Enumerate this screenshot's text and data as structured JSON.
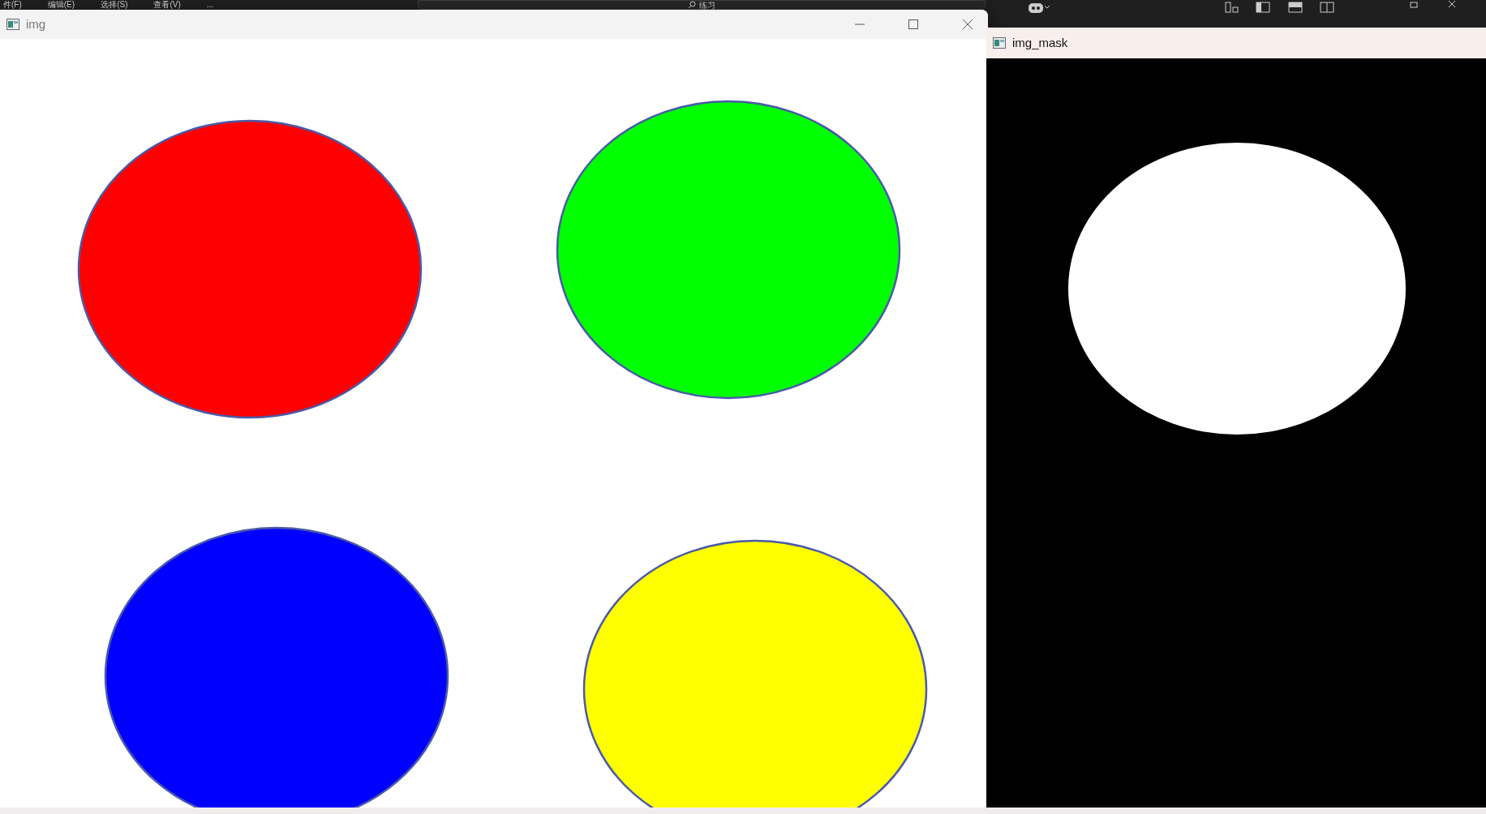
{
  "ide_menu": [
    "件(F)",
    "编辑(E)",
    "选择(S)",
    "查看(V)",
    "..."
  ],
  "search": {
    "value": "练习"
  },
  "img_window": {
    "title": "img",
    "ellipses": [
      {
        "color": "#ff0000"
      },
      {
        "color": "#00ff00"
      },
      {
        "color": "#0000ff"
      },
      {
        "color": "#ffff00"
      }
    ]
  },
  "mask_window": {
    "title": "img_mask"
  }
}
